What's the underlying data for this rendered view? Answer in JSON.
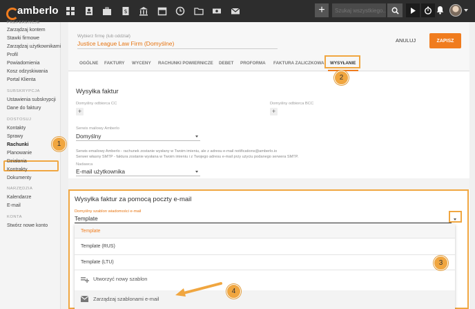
{
  "app": {
    "logo_text": "amberlo"
  },
  "topbar": {
    "icons": [
      "dashboard-icon",
      "contacts-icon",
      "briefcase-icon",
      "billing-icon",
      "bank-icon",
      "calendar-icon",
      "clock-icon",
      "folder-icon",
      "money-icon",
      "mail-icon"
    ],
    "search_placeholder": "Szukaj wszystkiego...",
    "plus_label": "+"
  },
  "sidebar": {
    "items": [
      {
        "label": "PREFERENCJE",
        "type": "head"
      },
      {
        "label": "Zarządzaj kontem",
        "type": "item"
      },
      {
        "label": "Stawki firmowe",
        "type": "item"
      },
      {
        "label": "Zarządzaj użytkownikami",
        "type": "item"
      },
      {
        "label": "Profil",
        "type": "item"
      },
      {
        "label": "Powiadomienia",
        "type": "item"
      },
      {
        "label": "Kosz odzyskiwania",
        "type": "item"
      },
      {
        "label": "Portal Klienta",
        "type": "item"
      },
      {
        "label": "SUBSKRYPCJA",
        "type": "head"
      },
      {
        "label": "Ustawienia subskrypcji",
        "type": "item"
      },
      {
        "label": "Dane do faktury",
        "type": "item"
      },
      {
        "label": "DOSTOSUJ",
        "type": "head"
      },
      {
        "label": "Kontakty",
        "type": "item"
      },
      {
        "label": "Sprawy",
        "type": "item"
      },
      {
        "label": "Rachunki",
        "type": "active"
      },
      {
        "label": "Planowanie",
        "type": "item"
      },
      {
        "label": "Działania",
        "type": "item"
      },
      {
        "label": "Kontrakty",
        "type": "item"
      },
      {
        "label": "Dokumenty",
        "type": "item"
      },
      {
        "label": "NARZĘDZIA",
        "type": "head"
      },
      {
        "label": "Kalendarze",
        "type": "item"
      },
      {
        "label": "E-mail",
        "type": "item"
      },
      {
        "label": "KONTA",
        "type": "head"
      },
      {
        "label": "Stwórz nowe konto",
        "type": "item"
      }
    ]
  },
  "firm": {
    "label": "Wybierz firmę (lub oddział)",
    "name": "Justice League Law Firm (Domyślne)"
  },
  "actions": {
    "cancel": "ANULUJ",
    "save": "ZAPISZ"
  },
  "tabs": [
    "OGÓLNE",
    "FAKTURY",
    "WYCENY",
    "RACHUNKI POWIERNICZE",
    "DEBET",
    "PROFORMA",
    "FAKTURA ZALICZKOWA",
    "WYSYŁANIE"
  ],
  "invoice_sending": {
    "title": "Wysyłka faktur",
    "cc_label": "Domyślny odbiorca CC",
    "bcc_label": "Domyślny odbiorca BCC",
    "mail_service_label": "Serwis mailowy Amberlo",
    "mail_service_value": "Domyślny",
    "info_line_1": "Serwis emailowy Amberlo - rachunek zostanie wysłany w Twoim imieniu, ale z adresu e-mail notifications@amberlo.io",
    "info_line_2": "Serwer własny SMTP - faktura zostanie wysłana w Twoim imieniu i z Twojego adresu e-mail przy użyciu podanego serwera SMTP.",
    "sender_label": "Nadawca",
    "sender_value": "E-mail użytkownika"
  },
  "email_sending": {
    "title": "Wysyłka faktur za pomocą poczty e-mail",
    "template_label": "Domyślny szablon wiadomości e-mail",
    "template_value": "Template",
    "options": [
      "Template",
      "Template (RUS)",
      "Template (LTU)"
    ],
    "create_template": "Utworzyć nowy szablon",
    "manage_templates": "Zarządzaj szablonami e-mail"
  },
  "callouts": [
    "1",
    "2",
    "3",
    "4"
  ],
  "colors": {
    "accent": "#f07c1e",
    "highlight": "#f0a640",
    "topbar": "#2d2d2d"
  }
}
